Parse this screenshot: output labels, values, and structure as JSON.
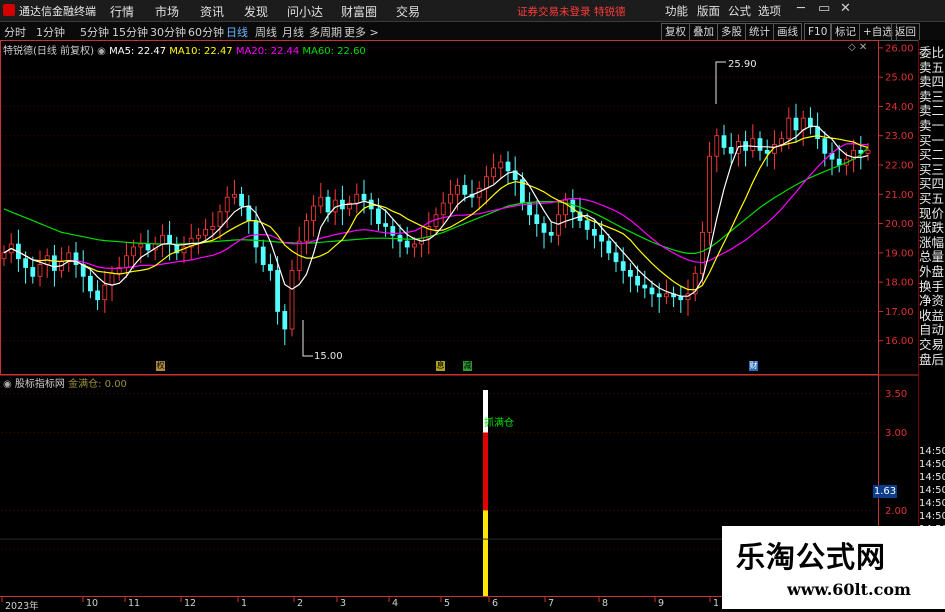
{
  "app": {
    "title": "通达信金融终端"
  },
  "menu": [
    "行情",
    "市场",
    "资讯",
    "发现",
    "问小达",
    "财富圈",
    "交易"
  ],
  "login_text": "证券交易未登录",
  "stock_title": "特锐德",
  "right_menu": [
    "功能",
    "版面",
    "公式",
    "选项"
  ],
  "window_controls": {
    "minimize": "─",
    "restore": "▭",
    "close": "✕"
  },
  "periods": [
    "分时",
    "1分钟",
    "5分钟",
    "15分钟",
    "30分钟",
    "60分钟",
    "日线",
    "周线",
    "月线",
    "多周期",
    "更多 >"
  ],
  "active_period": "日线",
  "tool_buttons": [
    "复权",
    "叠加",
    "多股",
    "统计",
    "画线",
    "F10",
    "标记",
    "+自选",
    "返回"
  ],
  "ma_legend": {
    "stock": "特锐德(日线 前复权)",
    "ma5": "MA5: 22.47",
    "ma10": "MA10: 22.47",
    "ma20": "MA20: 22.44",
    "ma60": "MA60: 22.60"
  },
  "colors": {
    "ma5": "#ffffff",
    "ma10": "#ffff00",
    "ma20": "#ff00ff",
    "ma60": "#00dd00",
    "up": "#ff3b3b",
    "down": "#54ffff",
    "axis": "#c83232"
  },
  "right_panel": [
    "委比",
    "卖五",
    "卖四",
    "卖三",
    "卖二",
    "卖一",
    "买一",
    "买二",
    "买三",
    "买四",
    "买五",
    "现价",
    "涨跌",
    "涨幅",
    "总量",
    "外盘",
    "换手",
    "净资",
    "收益",
    "自动",
    "交易",
    "盘后"
  ],
  "right_panel_times": [
    "14:50",
    "14:50",
    "14:50",
    "14:50",
    "14:50",
    "14:50",
    "14:50",
    "14:50"
  ],
  "indicator": {
    "name": "股标指标网",
    "signal_label": "金满仓: 0.00",
    "bar_label": "抓满仓",
    "cursor_value": "1.63",
    "signal": 0.0
  },
  "markers": [
    "权",
    "息",
    "减",
    "财"
  ],
  "annotations": {
    "high": "25.90",
    "low": "15.00"
  },
  "watermark": {
    "title": "乐淘公式网",
    "url": "www.60lt.com"
  },
  "chart_data": {
    "type": "line",
    "title": "特锐德(日线 前复权)",
    "price_axis": {
      "ticks": [
        16.0,
        17.0,
        18.0,
        19.0,
        20.0,
        21.0,
        22.0,
        23.0,
        24.0,
        25.0,
        26.0
      ],
      "ylim": [
        15.0,
        26.2
      ]
    },
    "indicator_axis": {
      "ticks": [
        1.5,
        2.0,
        3.0,
        3.5
      ],
      "ylim": [
        0.9,
        3.7
      ]
    },
    "x_labels": [
      "2023年",
      "10",
      "11",
      "12",
      "1",
      "2",
      "3",
      "4",
      "5",
      "6",
      "7",
      "8",
      "9",
      "1"
    ],
    "close": [
      19.0,
      19.3,
      18.8,
      18.5,
      18.2,
      18.6,
      18.9,
      18.4,
      18.7,
      19.0,
      18.6,
      18.2,
      17.7,
      17.4,
      17.9,
      18.3,
      18.5,
      18.9,
      19.2,
      19.3,
      19.1,
      19.3,
      19.6,
      19.3,
      19.0,
      19.2,
      19.5,
      19.6,
      19.8,
      19.9,
      20.4,
      20.9,
      21.0,
      20.6,
      20.1,
      19.2,
      18.6,
      18.4,
      17.0,
      16.4,
      18.4,
      19.4,
      20.1,
      20.6,
      20.9,
      20.4,
      20.8,
      20.5,
      20.7,
      21.0,
      20.8,
      20.5,
      20.0,
      19.9,
      19.6,
      19.4,
      19.2,
      19.3,
      19.5,
      19.9,
      20.3,
      20.7,
      21.0,
      21.3,
      21.0,
      20.9,
      21.2,
      21.6,
      21.9,
      22.1,
      21.8,
      21.5,
      20.7,
      20.3,
      20.0,
      19.7,
      19.6,
      20.3,
      20.8,
      20.4,
      20.1,
      19.8,
      19.6,
      19.4,
      19.0,
      18.7,
      18.4,
      18.2,
      17.9,
      17.8,
      17.6,
      17.5,
      17.6,
      17.5,
      17.4,
      17.6,
      18.3,
      19.7,
      22.3,
      23.0,
      22.6,
      22.4,
      22.8,
      22.5,
      22.9,
      22.5,
      22.4,
      22.7,
      22.9,
      23.6,
      23.2,
      23.6,
      23.3,
      22.9,
      22.4,
      22.2,
      22.0,
      22.2,
      22.5,
      22.4,
      22.5
    ],
    "ma60": [
      20.5,
      20.4,
      20.3,
      20.2,
      20.1,
      20.0,
      19.9,
      19.8,
      19.7,
      19.65,
      19.6,
      19.55,
      19.5,
      19.45,
      19.42,
      19.4,
      19.38,
      19.36,
      19.34,
      19.33,
      19.32,
      19.31,
      19.3,
      19.3,
      19.3,
      19.31,
      19.32,
      19.34,
      19.36,
      19.38,
      19.4,
      19.42,
      19.44,
      19.45,
      19.44,
      19.43,
      19.41,
      19.39,
      19.37,
      19.35,
      19.34,
      19.33,
      19.33,
      19.34,
      19.36,
      19.38,
      19.4,
      19.42,
      19.44,
      19.46,
      19.48,
      19.5,
      19.5,
      19.5,
      19.49,
      19.48,
      19.47,
      19.47,
      19.5,
      19.55,
      19.62,
      19.7,
      19.8,
      19.9,
      20.0,
      20.1,
      20.2,
      20.3,
      20.4,
      20.5,
      20.6,
      20.65,
      20.7,
      20.72,
      20.74,
      20.75,
      20.75,
      20.74,
      20.7,
      20.64,
      20.56,
      20.46,
      20.35,
      20.23,
      20.1,
      19.97,
      19.84,
      19.72,
      19.6,
      19.48,
      19.37,
      19.27,
      19.18,
      19.1,
      19.03,
      18.98,
      18.98,
      19.05,
      19.18,
      19.35,
      19.55,
      19.75,
      19.95,
      20.15,
      20.35,
      20.55,
      20.72,
      20.88,
      21.03,
      21.18,
      21.32,
      21.45,
      21.57,
      21.68,
      21.78,
      21.88,
      21.98,
      22.08,
      22.2,
      22.35,
      22.6
    ]
  }
}
